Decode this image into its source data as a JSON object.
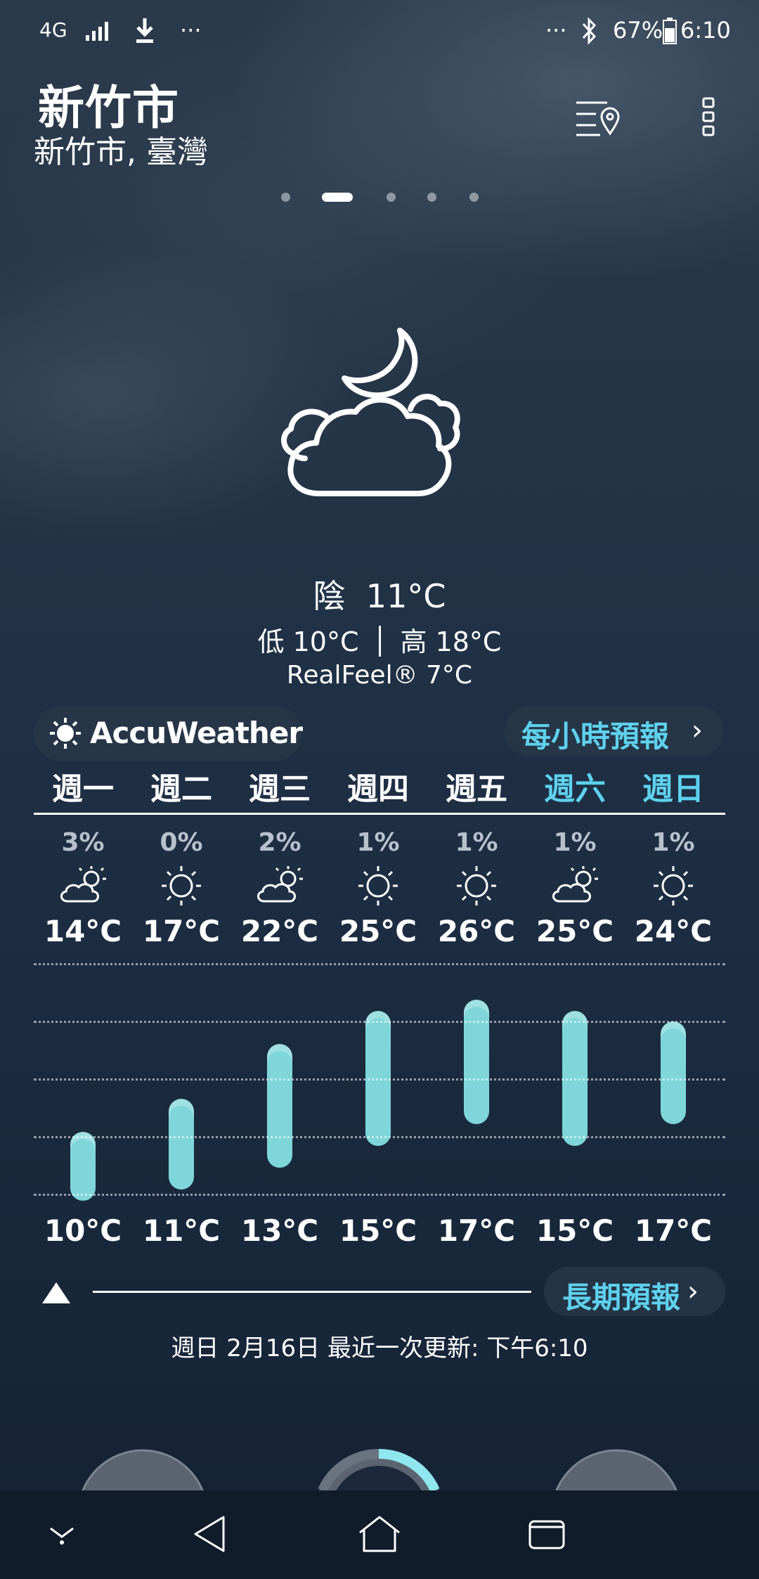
{
  "status_bar": {
    "network": "4G",
    "more_left": "···",
    "more_right": "···",
    "battery": "67%",
    "time": "6:10"
  },
  "location": {
    "city": "新竹市",
    "region": "新竹市, 臺灣"
  },
  "page_indicator": {
    "count": 5,
    "active": 1
  },
  "current": {
    "condition": "陰",
    "temp": "11°C",
    "low": "低 10°C",
    "high": "高 18°C",
    "realfeel": "RealFeel® 7°C"
  },
  "brand": "AccuWeather",
  "hourly_button": "每小時預報",
  "long_button": "長期預報",
  "forecast": {
    "days": [
      {
        "label": "週一",
        "precip": "3%",
        "icon": "partly-cloudy-sun-icon",
        "high": "14°C",
        "low": "10°C",
        "hi_val": 14,
        "lo_val": 10,
        "weekend": false
      },
      {
        "label": "週二",
        "precip": "0%",
        "icon": "sun-icon",
        "high": "17°C",
        "low": "11°C",
        "hi_val": 17,
        "lo_val": 11,
        "weekend": false
      },
      {
        "label": "週三",
        "precip": "2%",
        "icon": "partly-cloudy-sun-icon",
        "high": "22°C",
        "low": "13°C",
        "hi_val": 22,
        "lo_val": 13,
        "weekend": false
      },
      {
        "label": "週四",
        "precip": "1%",
        "icon": "sun-icon",
        "high": "25°C",
        "low": "15°C",
        "hi_val": 25,
        "lo_val": 15,
        "weekend": false
      },
      {
        "label": "週五",
        "precip": "1%",
        "icon": "sun-icon",
        "high": "26°C",
        "low": "17°C",
        "hi_val": 26,
        "lo_val": 17,
        "weekend": false
      },
      {
        "label": "週六",
        "precip": "1%",
        "icon": "partly-cloudy-sun-icon",
        "high": "25°C",
        "low": "15°C",
        "hi_val": 25,
        "lo_val": 15,
        "weekend": true
      },
      {
        "label": "週日",
        "precip": "1%",
        "icon": "sun-icon",
        "high": "24°C",
        "low": "17°C",
        "hi_val": 24,
        "lo_val": 17,
        "weekend": true
      }
    ]
  },
  "updated": "週日 2月16日 最近一次更新: 下午6:10",
  "colors": {
    "accent": "#5ed1ee",
    "bar": "#7fd6da"
  }
}
